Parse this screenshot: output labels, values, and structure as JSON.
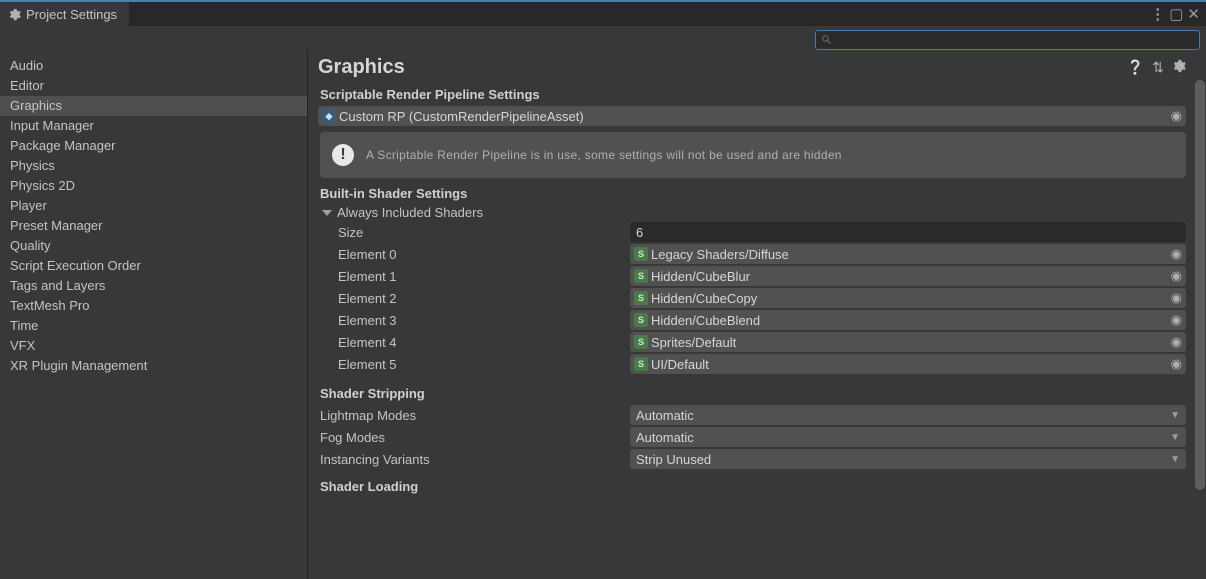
{
  "window": {
    "title": "Project Settings"
  },
  "search": {
    "placeholder": ""
  },
  "sidebar": {
    "items": [
      {
        "label": "Audio",
        "selected": false
      },
      {
        "label": "Editor",
        "selected": false
      },
      {
        "label": "Graphics",
        "selected": true
      },
      {
        "label": "Input Manager",
        "selected": false
      },
      {
        "label": "Package Manager",
        "selected": false
      },
      {
        "label": "Physics",
        "selected": false
      },
      {
        "label": "Physics 2D",
        "selected": false
      },
      {
        "label": "Player",
        "selected": false
      },
      {
        "label": "Preset Manager",
        "selected": false
      },
      {
        "label": "Quality",
        "selected": false
      },
      {
        "label": "Script Execution Order",
        "selected": false
      },
      {
        "label": "Tags and Layers",
        "selected": false
      },
      {
        "label": "TextMesh Pro",
        "selected": false
      },
      {
        "label": "Time",
        "selected": false
      },
      {
        "label": "VFX",
        "selected": false
      },
      {
        "label": "XR Plugin Management",
        "selected": false
      }
    ]
  },
  "panel": {
    "title": "Graphics",
    "srp": {
      "heading": "Scriptable Render Pipeline Settings",
      "value": "Custom RP (CustomRenderPipelineAsset)",
      "info": "A Scriptable Render Pipeline is in use, some settings will not be used and are hidden"
    },
    "builtin": {
      "heading": "Built-in Shader Settings",
      "foldout": "Always Included Shaders",
      "size_label": "Size",
      "size_value": "6",
      "elements": [
        {
          "label": "Element 0",
          "value": "Legacy Shaders/Diffuse"
        },
        {
          "label": "Element 1",
          "value": "Hidden/CubeBlur"
        },
        {
          "label": "Element 2",
          "value": "Hidden/CubeCopy"
        },
        {
          "label": "Element 3",
          "value": "Hidden/CubeBlend"
        },
        {
          "label": "Element 4",
          "value": "Sprites/Default"
        },
        {
          "label": "Element 5",
          "value": "UI/Default"
        }
      ]
    },
    "stripping": {
      "heading": "Shader Stripping",
      "rows": [
        {
          "label": "Lightmap Modes",
          "value": "Automatic"
        },
        {
          "label": "Fog Modes",
          "value": "Automatic"
        },
        {
          "label": "Instancing Variants",
          "value": "Strip Unused"
        }
      ]
    },
    "loading": {
      "heading": "Shader Loading"
    }
  }
}
